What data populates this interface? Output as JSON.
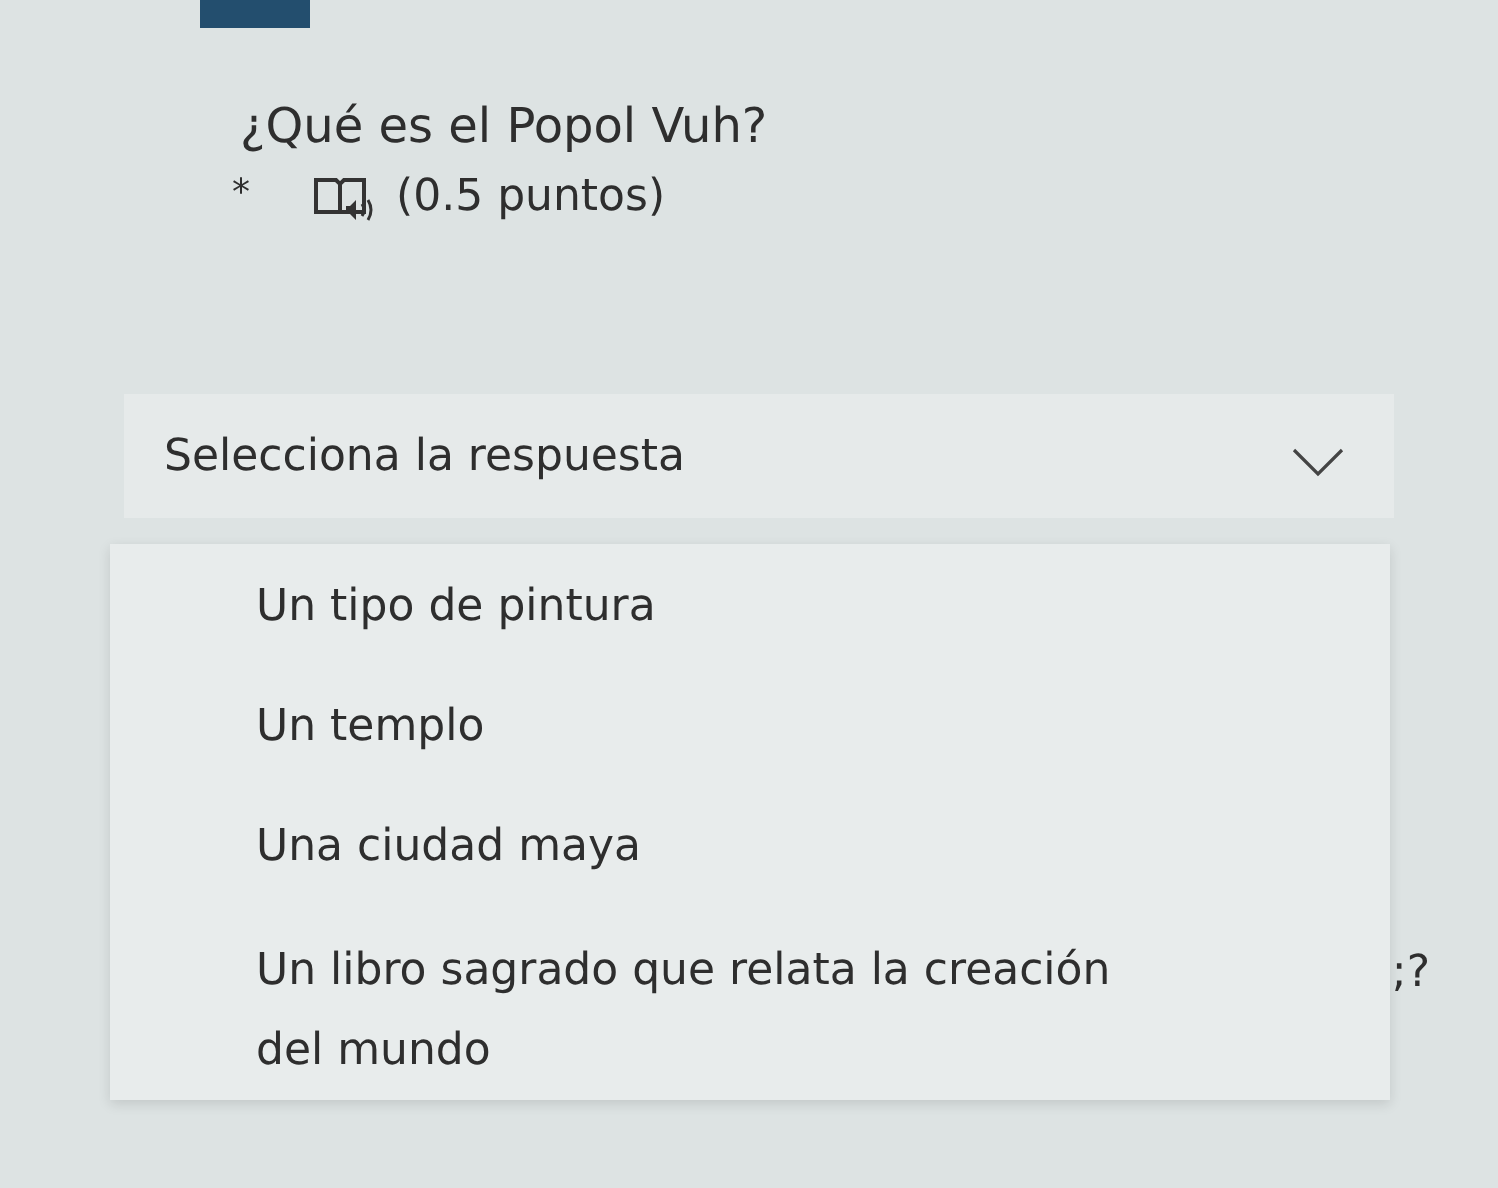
{
  "question": {
    "title": "¿Qué es el Popol Vuh?",
    "required_mark": "*",
    "points": "(0.5 puntos)"
  },
  "dropdown": {
    "placeholder": "Selecciona la respuesta",
    "expanded": true
  },
  "options": [
    {
      "label": "Un tipo de pintura"
    },
    {
      "label": "Un templo"
    },
    {
      "label": "Una ciudad maya"
    },
    {
      "label": "Un libro sagrado que relata la creación del mundo"
    }
  ],
  "stray_text": ";?"
}
